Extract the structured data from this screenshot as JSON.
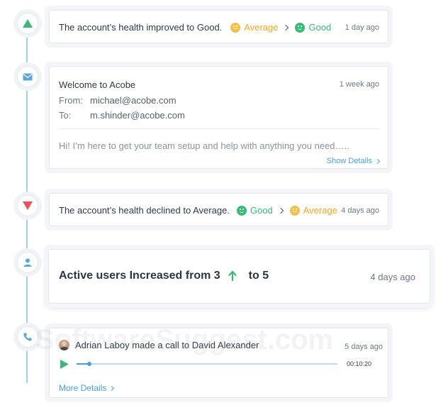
{
  "timeline": {
    "health_improved": {
      "text": "The account’s health improved to Good.",
      "from": "Average",
      "to": "Good",
      "time": "1 day ago"
    },
    "email": {
      "subject": "Welcome to Acobe",
      "time": "1 week ago",
      "from_label": "From:",
      "from_value": "michael@acobe.com",
      "to_label": "To:",
      "to_value": "m.shinder@acobe.com",
      "snippet": "Hi! I’m here to get your team setup and help with anything you need…..",
      "show_details": "Show Details"
    },
    "health_declined": {
      "text": "The account’s health declined to Average.",
      "from": "Good",
      "to": "Average",
      "time": "4 days ago"
    },
    "active_users": {
      "text_before": "Active users Increased from 3",
      "text_after": "to 5",
      "time": "4 days ago"
    },
    "call": {
      "text": "Adrian Laboy made a call to David Alexander",
      "time": "5 days ago",
      "duration": "00:10:20",
      "more_details": "More Details",
      "progress": 0.05
    }
  },
  "watermark": "SoftwareSuggest.com",
  "colors": {
    "good": "#3cb878",
    "average": "#f5a623",
    "link": "#4a9fd8",
    "timeline": "#9fd0ef",
    "up_arrow": "#3cb878",
    "down_arrow": "#e8545a"
  },
  "icons": {
    "node1": "triangle-up-icon",
    "node2": "envelope-icon",
    "node3": "triangle-down-icon",
    "node4": "user-icon",
    "node5": "phone-icon"
  }
}
